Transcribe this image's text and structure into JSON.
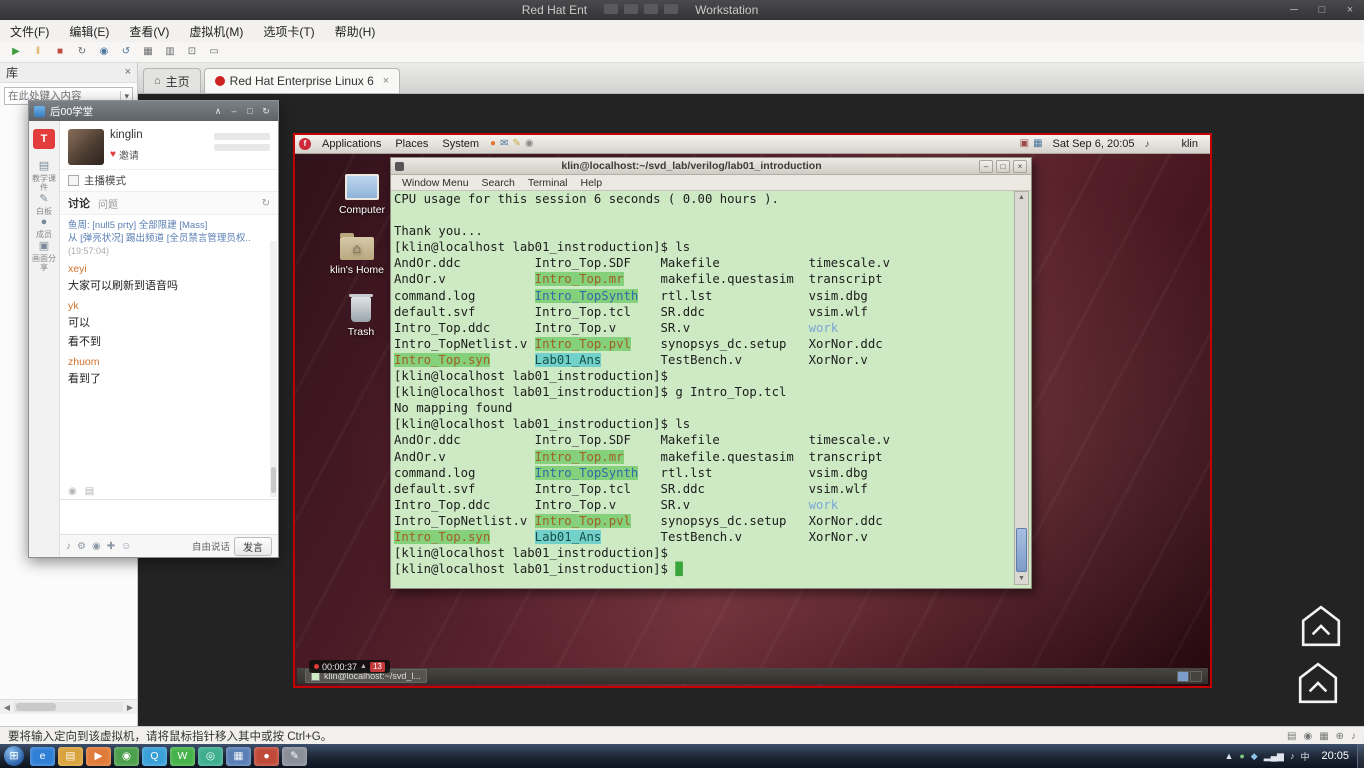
{
  "vmware": {
    "titlebar": {
      "title_left": "Red Hat Ent",
      "title_right": "Workstation",
      "controls": [
        "─",
        "□",
        "×"
      ]
    },
    "menu": [
      "文件(F)",
      "编辑(E)",
      "查看(V)",
      "虚拟机(M)",
      "选项卡(T)",
      "帮助(H)"
    ],
    "toolbar_icons": [
      {
        "name": "power-on",
        "glyph": "▶",
        "color": "#3e9e3e"
      },
      {
        "name": "suspend",
        "glyph": "‖",
        "color": "#d79b2f"
      },
      {
        "name": "power-off",
        "glyph": "■",
        "color": "#c14b3c"
      },
      {
        "name": "reset",
        "glyph": "↻",
        "color": "#6a6a6a"
      },
      {
        "name": "snapshot",
        "glyph": "◉",
        "color": "#49759c"
      },
      {
        "name": "revert-snapshot",
        "glyph": "↺",
        "color": "#49759c"
      },
      {
        "name": "snapshot-manager",
        "glyph": "▦",
        "color": "#6a6a6a"
      },
      {
        "name": "show-console",
        "glyph": "▥",
        "color": "#6a6a6a"
      },
      {
        "name": "fullscreen",
        "glyph": "⊡",
        "color": "#6a6a6a"
      },
      {
        "name": "unity-mode",
        "glyph": "▭",
        "color": "#6a6a6a"
      }
    ],
    "tabs": [
      {
        "name": "home",
        "label": "主页"
      },
      {
        "name": "vm",
        "label": "Red Hat Enterprise Linux 6",
        "close": "×"
      }
    ],
    "library": {
      "title": "库",
      "close": "×",
      "search_placeholder": "在此处键入内容"
    },
    "statusbar": {
      "text": "要将输入定向到该虚拟机，请将鼠标指针移入其中或按 Ctrl+G。",
      "device_icons": [
        {
          "name": "harddisk",
          "glyph": "▤"
        },
        {
          "name": "cdrom",
          "glyph": "◉"
        },
        {
          "name": "network-adapter",
          "glyph": "▦"
        },
        {
          "name": "usb-device",
          "glyph": "⊕"
        },
        {
          "name": "sound",
          "glyph": "♪"
        },
        {
          "name": "message-log",
          "glyph": "⚠"
        }
      ]
    }
  },
  "chat": {
    "title": "后00学堂",
    "controls": [
      {
        "name": "pin",
        "glyph": "∧"
      },
      {
        "name": "minimize",
        "glyph": "–"
      },
      {
        "name": "maximize",
        "glyph": "□"
      },
      {
        "name": "refresh",
        "glyph": "↻"
      }
    ],
    "broadcast_label": "T",
    "rail": [
      {
        "name": "courseware",
        "glyph": "▤",
        "label": "教学课件"
      },
      {
        "name": "whiteboard",
        "glyph": "✎",
        "label": "白板"
      },
      {
        "name": "members",
        "glyph": "●",
        "label": "成员"
      },
      {
        "name": "screen-share",
        "glyph": "▣",
        "label": "画面分享"
      }
    ],
    "user": "kinglin",
    "invite": "邀请",
    "host_mode": "主播模式",
    "discussion": "讨论",
    "discussion_sub": "问题",
    "messages": [
      {
        "type": "system",
        "text": "鱼周: [null5 prty] 全部限建 [Mass]"
      },
      {
        "type": "system",
        "text": "从 [弹亮状况] 踢出频道 [全员禁言管理员权.."
      },
      {
        "type": "ts",
        "text": "(19:57:04)"
      },
      {
        "type": "name",
        "text": "xeyi"
      },
      {
        "type": "text",
        "text": "大家可以刷新到语音吗"
      },
      {
        "type": "name",
        "text": "yk"
      },
      {
        "type": "text",
        "text": "可以"
      },
      {
        "type": "text",
        "text": "看不到"
      },
      {
        "type": "name",
        "text": "zhuom"
      },
      {
        "type": "text",
        "text": "看到了"
      }
    ],
    "toolbar_icons": [
      {
        "name": "mic",
        "glyph": "♪"
      },
      {
        "name": "settings",
        "glyph": "⚙"
      },
      {
        "name": "speaker",
        "glyph": "◉"
      },
      {
        "name": "hand-raise",
        "glyph": "✚"
      },
      {
        "name": "emoji",
        "glyph": "☺"
      }
    ],
    "free_talk": "自由说话",
    "speak": "发言"
  },
  "vm": {
    "panel": {
      "menus": [
        "Applications",
        "Places",
        "System"
      ],
      "left_icons": [
        {
          "name": "firefox",
          "glyph": "●",
          "color": "#e0762f"
        },
        {
          "name": "email",
          "glyph": "✉",
          "color": "#49759c"
        },
        {
          "name": "notes",
          "glyph": "✎",
          "color": "#c9a93a"
        },
        {
          "name": "screenshot",
          "glyph": "◉",
          "color": "#8a8a8a"
        }
      ],
      "right_icons": [
        {
          "name": "input-method",
          "glyph": "▣",
          "color": "#9a4a4a"
        },
        {
          "name": "network",
          "glyph": "▦",
          "color": "#49759c"
        }
      ],
      "date": "Sat Sep 6, 20:05",
      "volume_icon": "♪",
      "user": "klin"
    },
    "desktop_icons": [
      {
        "name": "computer",
        "label": "Computer"
      },
      {
        "name": "home",
        "label": "klin's Home"
      },
      {
        "name": "trash",
        "label": "Trash"
      }
    ],
    "terminal": {
      "title": "klin@localhost:~/svd_lab/verilog/lab01_introduction",
      "controls": [
        "–",
        "□",
        "×"
      ],
      "menus": [
        "Window Menu",
        "Search",
        "Terminal",
        "Help"
      ],
      "lines": [
        [
          [
            "CPU usage for this session 6 seconds ( 0.00 hours ).",
            "p"
          ]
        ],
        [],
        [
          [
            "Thank you...",
            "p"
          ]
        ],
        [
          [
            "[klin@localhost lab01_instroduction]$ ls",
            "p"
          ]
        ],
        [
          [
            "AndOr.ddc          Intro_Top.SDF    Makefile            timescale.v",
            "p"
          ]
        ],
        [
          [
            "AndOr.v            ",
            "p"
          ],
          [
            "Intro_Top.mr",
            "h"
          ],
          [
            "     ",
            "p"
          ],
          [
            "makefile.questasim  transcript",
            "p"
          ]
        ],
        [
          [
            "command.log        ",
            "p"
          ],
          [
            "Intro_TopSynth",
            "hc"
          ],
          [
            "   ",
            "p"
          ],
          [
            "rtl.lst             vsim.dbg",
            "p"
          ]
        ],
        [
          [
            "default.svf        Intro_Top.tcl    SR.ddc              vsim.wlf",
            "p"
          ]
        ],
        [
          [
            "Intro_Top.ddc      Intro_Top.v      SR.v                ",
            "p"
          ],
          [
            "work",
            "d"
          ]
        ],
        [
          [
            "Intro_TopNetlist.v ",
            "p"
          ],
          [
            "Intro_Top.pvl",
            "h"
          ],
          [
            "    ",
            "p"
          ],
          [
            "synopsys_dc.setup   XorNor.ddc",
            "p"
          ]
        ],
        [
          [
            "Intro_Top.syn",
            "h"
          ],
          [
            "      ",
            "p"
          ],
          [
            "Lab01_Ans",
            "hcy"
          ],
          [
            "        ",
            "p"
          ],
          [
            "TestBench.v         XorNor.v",
            "p"
          ]
        ],
        [
          [
            "[klin@localhost lab01_instroduction]$",
            "p"
          ]
        ],
        [
          [
            "[klin@localhost lab01_instroduction]$ g Intro_Top.tcl",
            "p"
          ]
        ],
        [
          [
            "No mapping found",
            "p"
          ]
        ],
        [
          [
            "[klin@localhost lab01_instroduction]$ ls",
            "p"
          ]
        ],
        [
          [
            "AndOr.ddc          Intro_Top.SDF    Makefile            timescale.v",
            "p"
          ]
        ],
        [
          [
            "AndOr.v            ",
            "p"
          ],
          [
            "Intro_Top.mr",
            "h"
          ],
          [
            "     ",
            "p"
          ],
          [
            "makefile.questasim  transcript",
            "p"
          ]
        ],
        [
          [
            "command.log        ",
            "p"
          ],
          [
            "Intro_TopSynth",
            "hc"
          ],
          [
            "   ",
            "p"
          ],
          [
            "rtl.lst             vsim.dbg",
            "p"
          ]
        ],
        [
          [
            "default.svf        Intro_Top.tcl    SR.ddc              vsim.wlf",
            "p"
          ]
        ],
        [
          [
            "Intro_Top.ddc      Intro_Top.v      SR.v                ",
            "p"
          ],
          [
            "work",
            "d"
          ]
        ],
        [
          [
            "Intro_TopNetlist.v ",
            "p"
          ],
          [
            "Intro_Top.pvl",
            "h"
          ],
          [
            "    ",
            "p"
          ],
          [
            "synopsys_dc.setup   XorNor.ddc",
            "p"
          ]
        ],
        [
          [
            "Intro_Top.syn",
            "h"
          ],
          [
            "      ",
            "p"
          ],
          [
            "Lab01_Ans",
            "hcy"
          ],
          [
            "        ",
            "p"
          ],
          [
            "TestBench.v         XorNor.v",
            "p"
          ]
        ],
        [
          [
            "[klin@localhost lab01_instroduction]$",
            "p"
          ]
        ],
        [
          [
            "[klin@localhost lab01_instroduction]$ ",
            "p"
          ],
          [
            "█",
            "cur"
          ]
        ]
      ]
    },
    "bottom_panel": {
      "task": "klin@localhost:~/svd_l...",
      "recording_time": "00:00:37",
      "badge": "13"
    }
  },
  "taskbar": {
    "apps": [
      {
        "name": "internet-explorer",
        "glyph": "e",
        "bg": "#2f7fd6"
      },
      {
        "name": "file-explorer",
        "glyph": "▤",
        "bg": "#d9a33c"
      },
      {
        "name": "media-player",
        "glyph": "▶",
        "bg": "#e07b39"
      },
      {
        "name": "chrome",
        "glyph": "◉",
        "bg": "#4c9f4c"
      },
      {
        "name": "qq",
        "glyph": "Q",
        "bg": "#3aa0d8"
      },
      {
        "name": "wechat",
        "glyph": "W",
        "bg": "#46b34a"
      },
      {
        "name": "browser-360",
        "glyph": "◎",
        "bg": "#3fae8f"
      },
      {
        "name": "vmware-workstation",
        "glyph": "▦",
        "bg": "#5a7fb5"
      },
      {
        "name": "screen-recorder",
        "glyph": "●",
        "bg": "#c04a3a"
      },
      {
        "name": "notepad",
        "glyph": "✎",
        "bg": "#8a8f98"
      }
    ],
    "tray": [
      {
        "name": "hidden-icons",
        "glyph": "▲"
      },
      {
        "name": "recorder-tray",
        "glyph": "●",
        "color": "#7fc97f"
      },
      {
        "name": "security-tray",
        "glyph": "◆",
        "color": "#8fc3ea"
      },
      {
        "name": "network-tray",
        "glyph": "▂▄▆"
      },
      {
        "name": "volume-tray",
        "glyph": "♪"
      },
      {
        "name": "ime-indicator",
        "glyph": "中"
      }
    ],
    "clock": "20:05"
  }
}
